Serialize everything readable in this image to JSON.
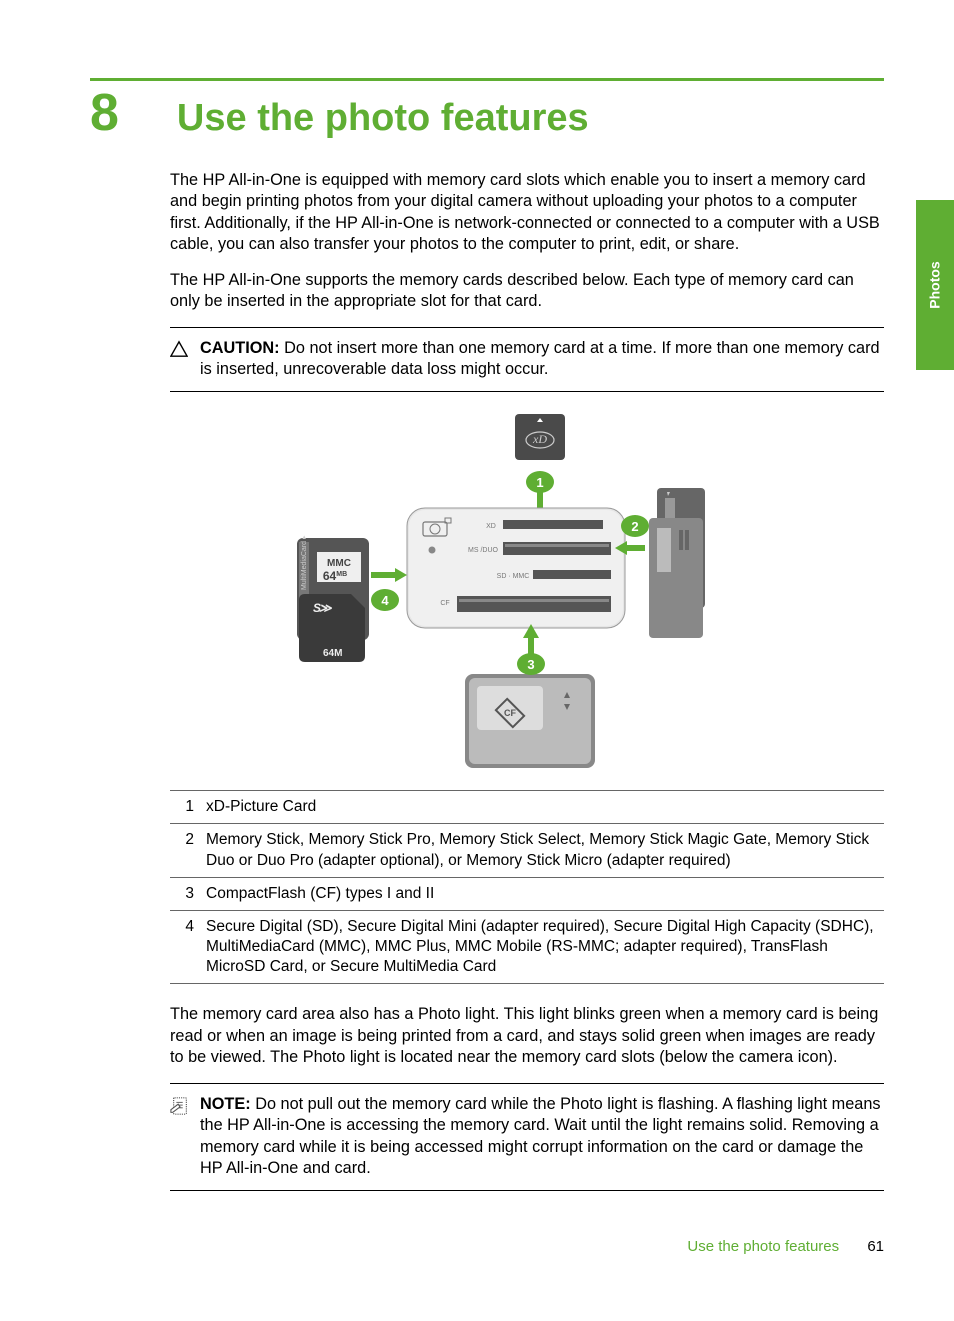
{
  "chapter": {
    "number": "8",
    "title": "Use the photo features"
  },
  "paragraphs": {
    "p1": "The HP All-in-One is equipped with memory card slots which enable you to insert a memory card and begin printing photos from your digital camera without uploading your photos to a computer first. Additionally, if the HP All-in-One is network-connected or connected to a computer with a USB cable, you can also transfer your photos to the computer to print, edit, or share.",
    "p2": "The HP All-in-One supports the memory cards described below. Each type of memory card can only be inserted in the appropriate slot for that card.",
    "p3": "The memory card area also has a Photo light. This light blinks green when a memory card is being read or when an image is being printed from a card, and stays solid green when images are ready to be viewed. The Photo light is located near the memory card slots (below the camera icon)."
  },
  "caution": {
    "label": "CAUTION:",
    "text": "Do not insert more than one memory card at a time. If more than one memory card is inserted, unrecoverable data loss might occur."
  },
  "note": {
    "label": "NOTE:",
    "text": "Do not pull out the memory card while the Photo light is flashing. A flashing light means the HP All-in-One is accessing the memory card. Wait until the light remains solid. Removing a memory card while it is being accessed might corrupt information on the card or damage the HP All-in-One and card."
  },
  "card_table": [
    {
      "n": "1",
      "desc": "xD-Picture Card"
    },
    {
      "n": "2",
      "desc": "Memory Stick, Memory Stick Pro, Memory Stick Select, Memory Stick Magic Gate, Memory Stick Duo or Duo Pro (adapter optional), or Memory Stick Micro (adapter required)"
    },
    {
      "n": "3",
      "desc": "CompactFlash (CF) types I and II"
    },
    {
      "n": "4",
      "desc": "Secure Digital (SD), Secure Digital Mini (adapter required), Secure Digital High Capacity (SDHC), MultiMediaCard (MMC), MMC Plus, MMC Mobile (RS-MMC; adapter required), TransFlash MicroSD Card, or Secure MultiMedia Card"
    }
  ],
  "figure": {
    "labels": {
      "xd_slot": "XD",
      "ms_slot": "MS /DUO",
      "sd_slot": "SD · MMC",
      "cf_slot": "CF",
      "mmc_card": "MMC",
      "mmc_size": "64",
      "mmc_unit": "MB",
      "sd_size": "64M"
    },
    "bubbles": {
      "b1": "1",
      "b2": "2",
      "b3": "3",
      "b4": "4"
    }
  },
  "footer": {
    "title": "Use the photo features",
    "page": "61"
  },
  "tab": "Photos"
}
